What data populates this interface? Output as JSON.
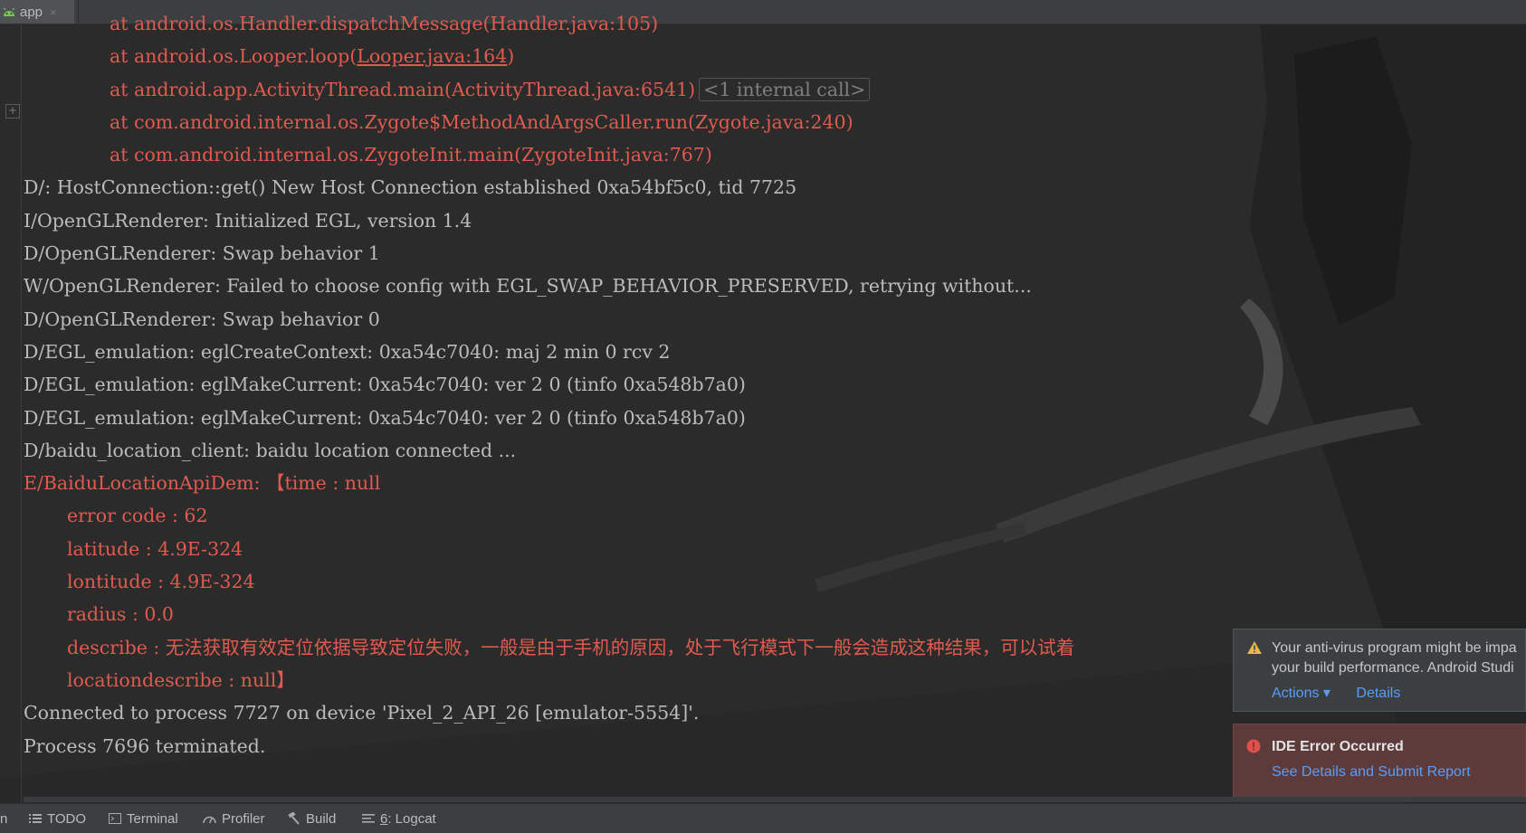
{
  "tab": {
    "label": "app",
    "close": "×"
  },
  "console": {
    "lines": [
      {
        "text": "at android.os.Handler.dispatchMessage(Handler.java:105)",
        "type": "err",
        "indent": 1
      },
      {
        "pre": "at android.os.Looper.loop(",
        "link": "Looper.java:164",
        "post": ")",
        "type": "err",
        "indent": 1
      },
      {
        "text": "at android.app.ActivityThread.main(ActivityThread.java:6541)",
        "extra": "<1 internal call>",
        "type": "err",
        "indent": 1
      },
      {
        "text": "at com.android.internal.os.Zygote$MethodAndArgsCaller.run(Zygote.java:240)",
        "type": "err",
        "indent": 1
      },
      {
        "text": "at com.android.internal.os.ZygoteInit.main(ZygoteInit.java:767)",
        "type": "err",
        "indent": 1
      },
      {
        "text": "D/: HostConnection::get() New Host Connection established 0xa54bf5c0, tid 7725",
        "type": "normal",
        "indent": 0
      },
      {
        "text": "I/OpenGLRenderer: Initialized EGL, version 1.4",
        "type": "normal",
        "indent": 0
      },
      {
        "text": "D/OpenGLRenderer: Swap behavior 1",
        "type": "normal",
        "indent": 0
      },
      {
        "text": "W/OpenGLRenderer: Failed to choose config with EGL_SWAP_BEHAVIOR_PRESERVED, retrying without...",
        "type": "normal",
        "indent": 0
      },
      {
        "text": "D/OpenGLRenderer: Swap behavior 0",
        "type": "normal",
        "indent": 0
      },
      {
        "text": "D/EGL_emulation: eglCreateContext: 0xa54c7040: maj 2 min 0 rcv 2",
        "type": "normal",
        "indent": 0
      },
      {
        "text": "D/EGL_emulation: eglMakeCurrent: 0xa54c7040: ver 2 0 (tinfo 0xa548b7a0)",
        "type": "normal",
        "indent": 0
      },
      {
        "text": "D/EGL_emulation: eglMakeCurrent: 0xa54c7040: ver 2 0 (tinfo 0xa548b7a0)",
        "type": "normal",
        "indent": 0
      },
      {
        "text": "D/baidu_location_client: baidu location connected ...",
        "type": "normal",
        "indent": 0
      },
      {
        "text": "E/BaiduLocationApiDem: 【time : null",
        "type": "err",
        "indent": 0
      },
      {
        "text": "error code : 62",
        "type": "err",
        "indent": 2
      },
      {
        "text": "latitude : 4.9E-324",
        "type": "err",
        "indent": 2
      },
      {
        "text": "lontitude : 4.9E-324",
        "type": "err",
        "indent": 2
      },
      {
        "text": "radius : 0.0",
        "type": "err",
        "indent": 2
      },
      {
        "text": "describe : 无法获取有效定位依据导致定位失败，一般是由于手机的原因，处于飞行模式下一般会造成这种结果，可以试着",
        "type": "err",
        "indent": 2
      },
      {
        "text": "locationdescribe : null】",
        "type": "err",
        "indent": 2
      },
      {
        "text": "Connected to process 7727 on device 'Pixel_2_API_26 [emulator-5554]'.",
        "type": "normal",
        "indent": 0
      },
      {
        "text": "Process 7696 terminated.",
        "type": "normal",
        "indent": 0
      }
    ]
  },
  "notifications": {
    "warning": {
      "icon": "warning-icon",
      "line1": "Your anti-virus program might be impa",
      "line2": "your build performance. Android Studi",
      "actions_label": "Actions ▾",
      "details_label": "Details"
    },
    "error": {
      "icon": "error-icon",
      "title": "IDE Error Occurred",
      "link": "See Details and Submit Report"
    }
  },
  "toolbar": {
    "edge": "n",
    "todo": "TODO",
    "terminal": "Terminal",
    "profiler": "Profiler",
    "build": "Build",
    "logcat_num": "6",
    "logcat": ": Logcat"
  },
  "colors": {
    "error": "#e05a4f",
    "normal": "#bbbbbb",
    "link": "#589df6",
    "bg": "#2b2b2b"
  }
}
